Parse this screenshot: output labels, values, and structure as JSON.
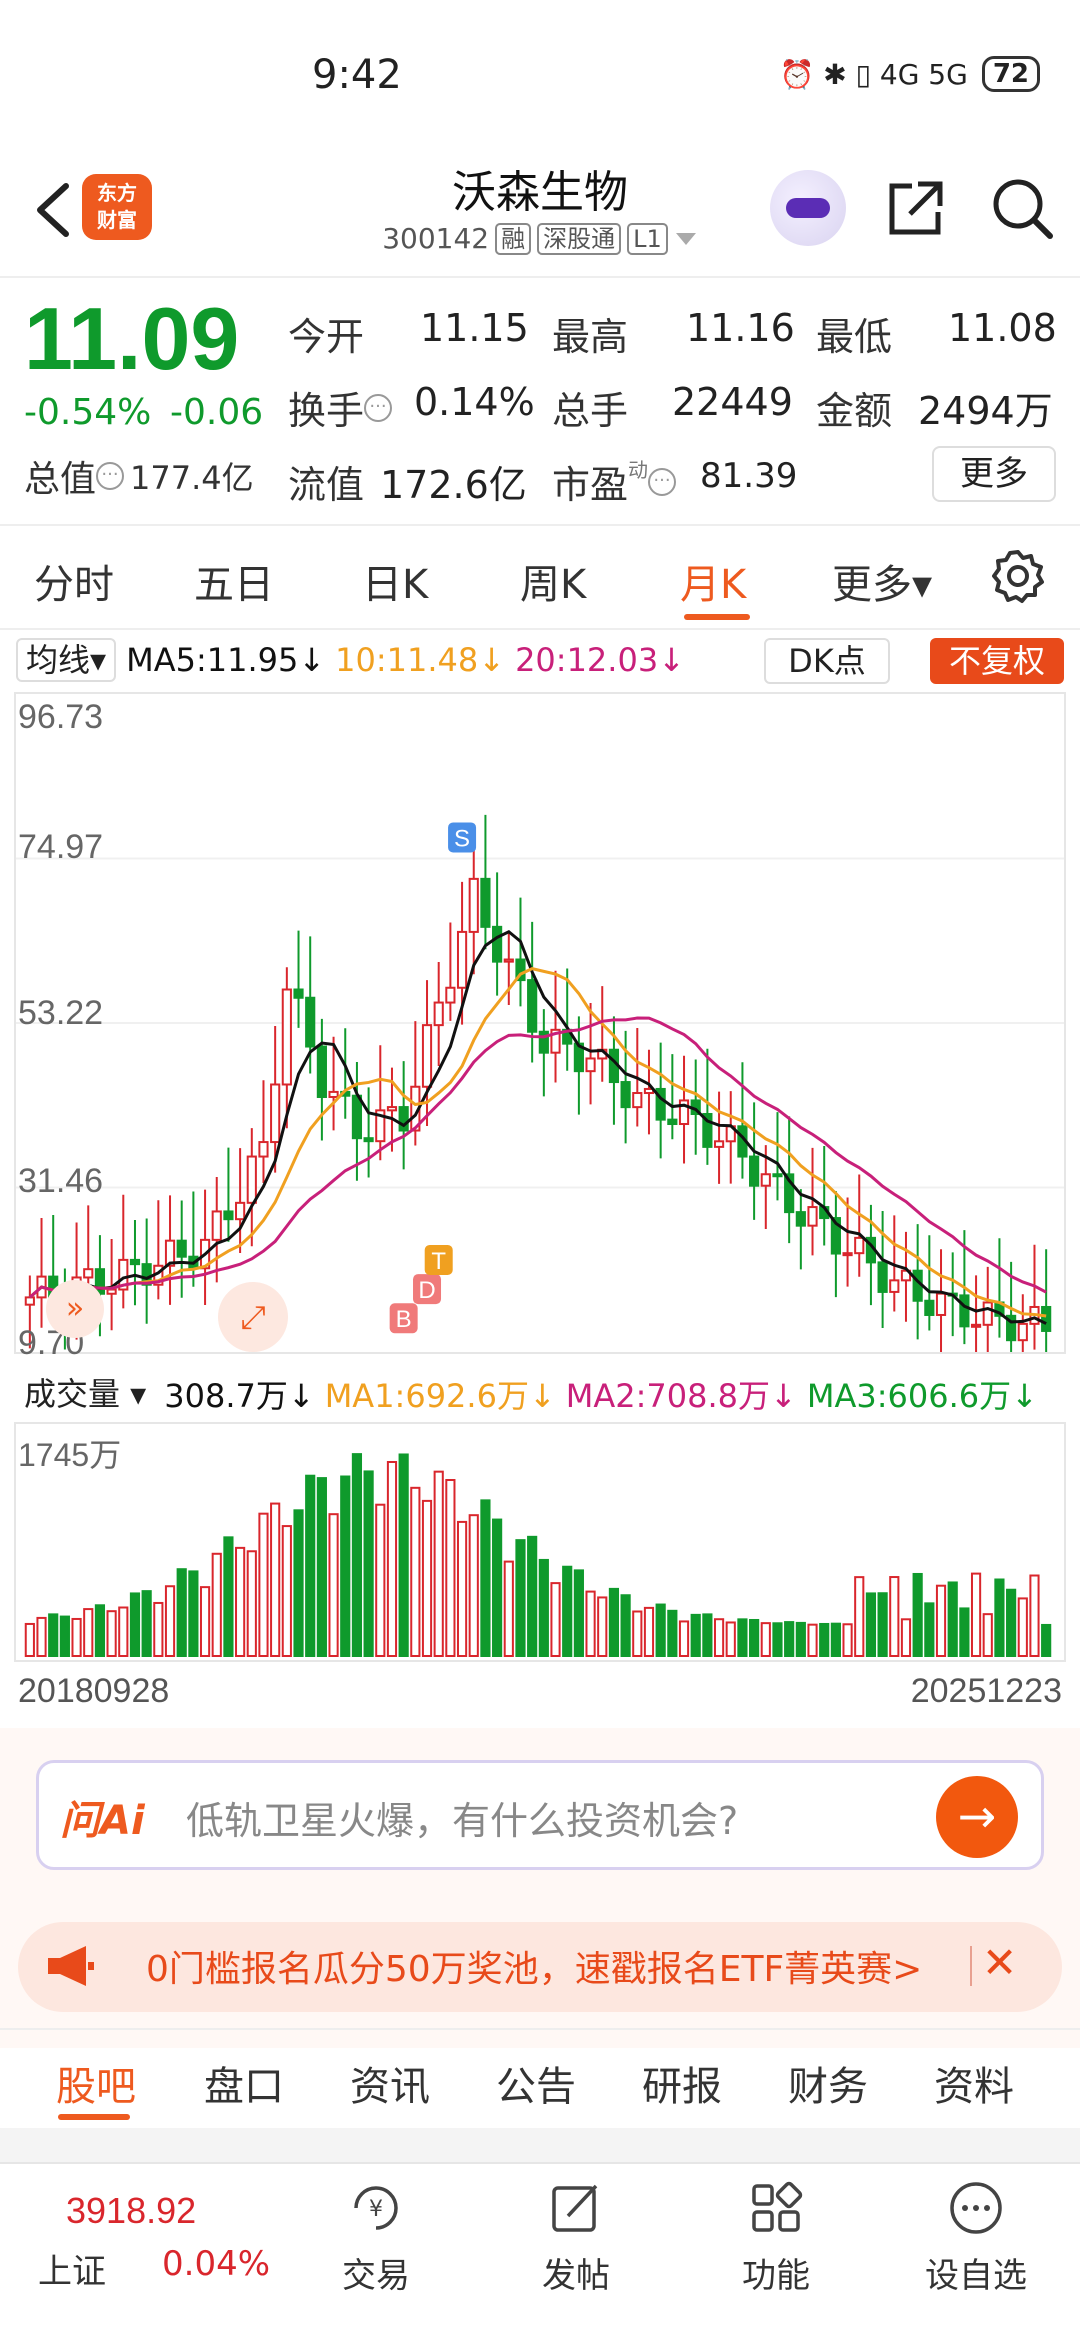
{
  "status_bar": {
    "time": "9:42",
    "icons": "⏰ ✱ ▯ 4G 5G",
    "battery": "72"
  },
  "header": {
    "stock_name": "沃森生物",
    "stock_code": "300142",
    "tags": [
      "融",
      "深股通",
      "L1"
    ],
    "logo_text_1": "东方",
    "logo_text_2": "财富"
  },
  "quote": {
    "price": "11.09",
    "change_pct": "-0.54%",
    "change_abs": "-0.06",
    "open_label": "今开",
    "open": "11.15",
    "high_label": "最高",
    "high": "11.16",
    "low_label": "最低",
    "low": "11.08",
    "turnover_label": "换手",
    "turnover": "0.14%",
    "volume_label": "总手",
    "volume": "22449",
    "amount_label": "金额",
    "amount": "2494万",
    "mktcap_label": "总值",
    "mktcap": "177.4亿",
    "float_label": "流值",
    "float_cap": "172.6亿",
    "pe_label": "市盈",
    "pe_sup": "动",
    "pe": "81.39",
    "more_label": "更多"
  },
  "period_tabs": [
    "分时",
    "五日",
    "日K",
    "周K",
    "月K",
    "更多▾"
  ],
  "active_period": "月K",
  "ma": {
    "selector": "均线▾",
    "ma5": "MA5:11.95↓",
    "ma10": "10:11.48↓",
    "ma20": "20:12.03↓",
    "dk": "DK点",
    "fq": "不复权"
  },
  "kchart_labels": {
    "y1": "96.73",
    "y2": "74.97",
    "y3": "53.22",
    "y4": "31.46",
    "y5": "9.70"
  },
  "markers": {
    "s": "S",
    "b": "B",
    "d": "D",
    "t": "T"
  },
  "volume": {
    "selector": "成交量 ▾",
    "current": "308.7万↓",
    "ma1": "MA1:692.6万↓",
    "ma2": "MA2:708.8万↓",
    "ma3": "MA3:606.6万↓",
    "ymax": "1745万"
  },
  "dates": {
    "start": "20180928",
    "end": "20251223"
  },
  "ai": {
    "logo": "问Ai",
    "placeholder": "低轨卫星火爆，有什么投资机会?"
  },
  "promo": {
    "text": "0门槛报名瓜分50万奖池，速戳报名ETF菁英赛>"
  },
  "bottom_tabs": [
    "股吧",
    "盘口",
    "资讯",
    "公告",
    "研报",
    "财务",
    "资料"
  ],
  "index": {
    "value": "3918.92",
    "name": "上证",
    "pct": "0.04%"
  },
  "nav": [
    "交易",
    "发帖",
    "功能",
    "设自选"
  ],
  "colors": {
    "accent": "#ee5a1f",
    "up": "#d9262c",
    "down": "#0f9a2c",
    "ma5": "#111111",
    "ma10": "#f0a020",
    "ma20": "#c8207a"
  }
}
